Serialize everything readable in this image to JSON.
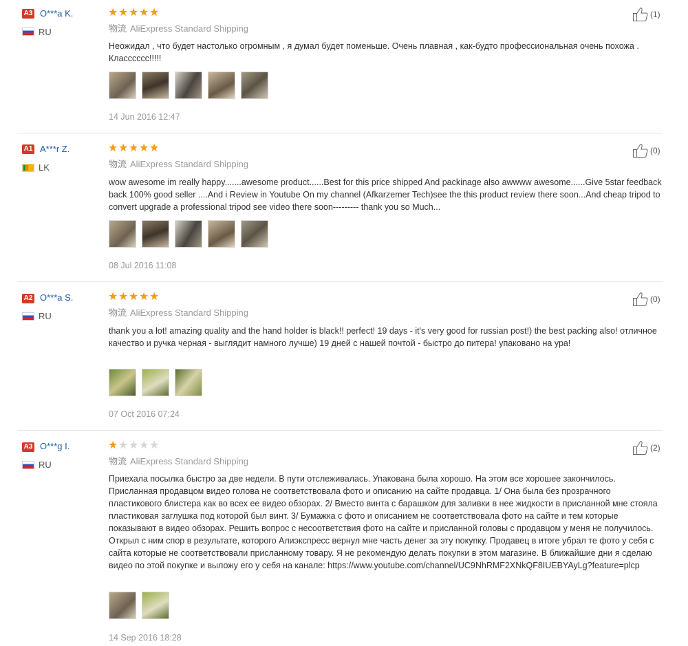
{
  "reviews": [
    {
      "badge": "A3",
      "name": "O***a K.",
      "country": "RU",
      "flag": "ru",
      "stars": 5,
      "shipping_cn": "物流",
      "shipping": "AliExpress Standard Shipping",
      "text": "Неожидал , что будет настолько огромным , я думал будет поменьше. Очень плавная , как-будто профессиональная очень похожа . Класссссс!!!!!",
      "photos": [
        "photo-1",
        "photo-2",
        "photo-3",
        "photo-4",
        "photo-5"
      ],
      "date": "14 Jun 2016 12:47",
      "helpful_count": "(1)"
    },
    {
      "badge": "A1",
      "name": "A***r Z.",
      "country": "LK",
      "flag": "lk",
      "stars": 5,
      "shipping_cn": "物流",
      "shipping": "AliExpress Standard Shipping",
      "text": "wow awesome im really happy.......awesome product......Best for this price shipped And packinage also awwww awesome......Give 5star feedback back 100% good seller ....And i Review in Youtube On my channel (Afkarzemer Tech)see the this product review there soon...And cheap tripod to convert upgrade a professional tripod see video there soon--------- thank you so Much...",
      "photos": [
        "photo-1",
        "photo-2",
        "photo-3",
        "photo-4",
        "photo-5"
      ],
      "date": "08 Jul 2016 11:08",
      "helpful_count": "(0)"
    },
    {
      "badge": "A2",
      "name": "O***a S.",
      "country": "RU",
      "flag": "ru",
      "stars": 5,
      "shipping_cn": "物流",
      "shipping": "AliExpress Standard Shipping",
      "text": "thank you a lot! amazing quality and the hand holder is black!! perfect! 19 days - it's very good for russian post!) the best packing also! отличное качество и ручка черная - выглядит намного лучше) 19 дней с нашей почтой - быстро до питера! упаковано на ура!",
      "photos": [
        "photo-1",
        "photo-2",
        "photo-3"
      ],
      "date": "07 Oct 2016 07:24",
      "helpful_count": "(0)"
    },
    {
      "badge": "A3",
      "name": "O***g I.",
      "country": "RU",
      "flag": "ru",
      "stars": 1,
      "shipping_cn": "物流",
      "shipping": "AliExpress Standard Shipping",
      "text": "Приехала посылка быстро за две недели. В пути отслеживалась. Упакована была хорошо. На этом все хорошее закончилось. Присланная продавцом видео голова не соответствовала фото и описанию на сайте продавца. 1/ Она была без прозрачного пластикового блистера как во всех ее видео обзорах. 2/ Вместо винта с барашком для заливки в нее жидкости в присланной мне стояла пластиковая заглушка под которой был винт. 3/ Бумажка с фото и описанием не соответствовала фото на сайте и тем которые показывают в видео обзорах. Решить вопрос с несоответствия фото на сайте и присланной головы с продавцом у меня не получилось. Открыл с ним спор в результате, которого Алиэкспресс вернул мне часть денег за эту покупку. Продавец в итоге убрал те фото у себя с сайта которые не соответствовали присланному товару. Я не рекомендую делать покупки в этом магазине. В ближайшие дни я сделаю видео по этой покупке и выложу его у себя на канале: https://www.youtube.com/channel/UC9NhRMF2XNkQF8IUEBYAyLg?feature=plcp",
      "photos": [
        "photo-1",
        "photo-2"
      ],
      "date": "14 Sep 2016 18:28",
      "helpful_count": "(2)"
    }
  ],
  "colors": {
    "badge": "#d23b2a",
    "username": "#1a5da8",
    "star_on": "#f39c12",
    "star_off": "#d6d6d6",
    "muted": "#999999"
  },
  "icons": {
    "helpful": "thumbs-up-icon",
    "flag_ru": "russia-flag-icon",
    "flag_lk": "sri-lanka-flag-icon",
    "star": "star-icon"
  }
}
